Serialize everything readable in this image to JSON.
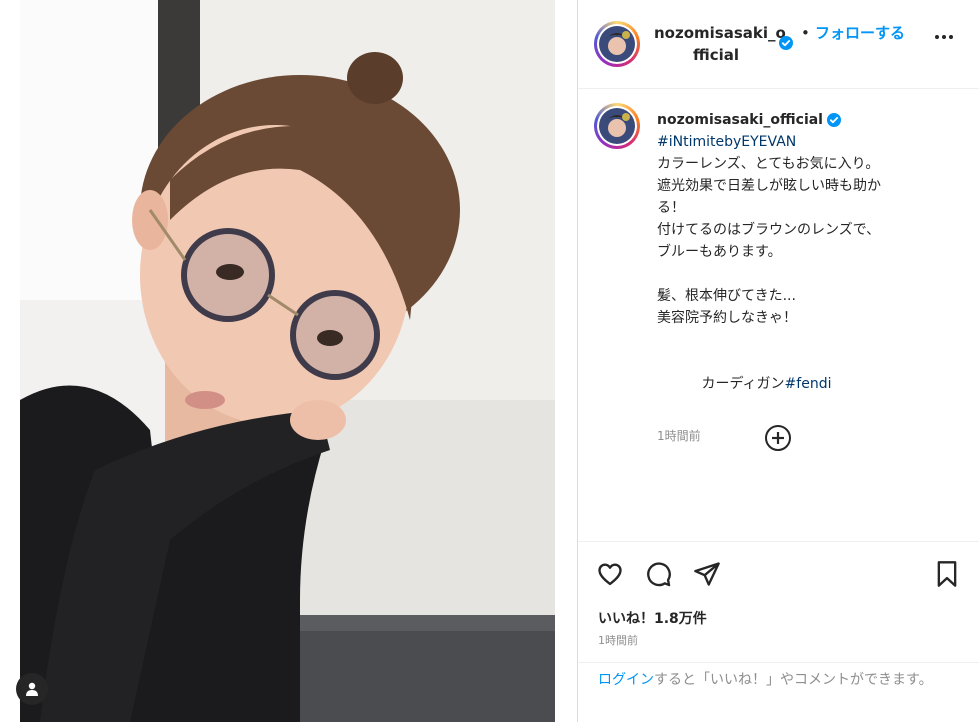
{
  "post": {
    "username": "nozomisasaki_official",
    "header_username_line1": "nozomisasaki_o",
    "header_username_line2": "fficial",
    "separator": "•",
    "follow_label": "フォローする",
    "caption": {
      "hashtag_brand": "#iNtimitebyEYEVAN",
      "lines": [
        "カラーレンズ、とてもお気に入り。",
        "遮光効果で日差しが眩しい時も助か",
        "る！",
        "付けてるのはブラウンのレンズで、",
        "ブルーもあります。",
        "",
        "髪、根本伸びてきた...",
        "美容院予約しなきゃ！",
        ""
      ],
      "last_line_prefix": "カーディガン",
      "hashtag_fendi": "#fendi",
      "time": "1時間前"
    },
    "likes_label": "いいね！1.8万件",
    "post_time": "1時間前",
    "login_prompt": {
      "link": "ログイン",
      "rest": "すると「いいね！」やコメントができます。"
    }
  },
  "icons": {
    "header": [
      "verified-badge-icon",
      "more-options-icon"
    ],
    "actions": [
      "heart-icon",
      "comment-icon",
      "share-icon",
      "bookmark-icon"
    ],
    "other": [
      "add-comment-icon",
      "user-tag-icon"
    ]
  },
  "colors": {
    "link_blue": "#0095f6",
    "hashtag_navy": "#00376b",
    "muted_gray": "#8e8e8e",
    "text": "#262626",
    "verified_blue": "#0095f6"
  }
}
